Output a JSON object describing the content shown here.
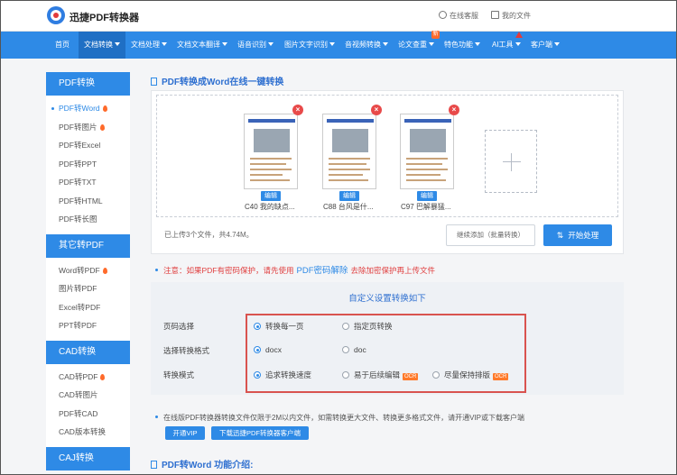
{
  "header": {
    "brand": "迅捷PDF转换器",
    "service_link": "在线客服",
    "files_link": "我的文件"
  },
  "nav": {
    "items": [
      {
        "label": "首页"
      },
      {
        "label": "文档转换"
      },
      {
        "label": "文档处理"
      },
      {
        "label": "文档文本翻译"
      },
      {
        "label": "语音识别"
      },
      {
        "label": "图片文字识别"
      },
      {
        "label": "音视频转换"
      },
      {
        "label": "论文查重"
      },
      {
        "label": "特色功能"
      },
      {
        "label": "AI工具"
      },
      {
        "label": "客户端"
      }
    ],
    "new_badge": "新",
    "accent": "#2e8ae6"
  },
  "sidebar": {
    "groups": [
      {
        "title": "PDF转换",
        "items": [
          "PDF转Word",
          "PDF转图片",
          "PDF转Excel",
          "PDF转PPT",
          "PDF转TXT",
          "PDF转HTML",
          "PDF转长图"
        ]
      },
      {
        "title": "其它转PDF",
        "items": [
          "Word转PDF",
          "图片转PDF",
          "Excel转PDF",
          "PPT转PDF"
        ]
      },
      {
        "title": "CAD转换",
        "items": [
          "CAD转PDF",
          "CAD转图片",
          "PDF转CAD",
          "CAD版本转换"
        ]
      },
      {
        "title": "CAJ转换"
      }
    ]
  },
  "main": {
    "section_title": "PDF转换成Word在线一键转换",
    "files": [
      {
        "name": "C40 我的缺点...",
        "edit": "编辑"
      },
      {
        "name": "C88 台风是什...",
        "edit": "编辑"
      },
      {
        "name": "C97 巴解暴猛...",
        "edit": "编辑"
      }
    ],
    "upload_count": "已上传3个文件，共4.74M。",
    "continue_button": "继续添加（批量转换）",
    "start_button": "开始处理",
    "notice_prefix": "注意：如果PDF有密码保护，请先使用",
    "notice_link": "PDF密码解除",
    "notice_suffix": "去除加密保护再上传文件",
    "settings": {
      "title": "自定义设置转换如下",
      "rows": [
        {
          "label": "页码选择",
          "options": [
            "转换每一页",
            "指定页转换"
          ]
        },
        {
          "label": "选择转换格式",
          "options": [
            "docx",
            "doc"
          ]
        },
        {
          "label": "转换模式",
          "options": [
            "追求转换速度",
            "易于后续编辑",
            "尽量保持排版"
          ]
        }
      ],
      "ocr": "OCR"
    },
    "tip": "在线版PDF转换器转换文件仅限于2M以内文件，如需转换更大文件、转换更多格式文件，请开通VIP或下载客户端",
    "vip_button": "开通VIP",
    "download_button": "下载迅捷PDF转换器客户端",
    "intro_title": "PDF转Word 功能介绍:"
  }
}
